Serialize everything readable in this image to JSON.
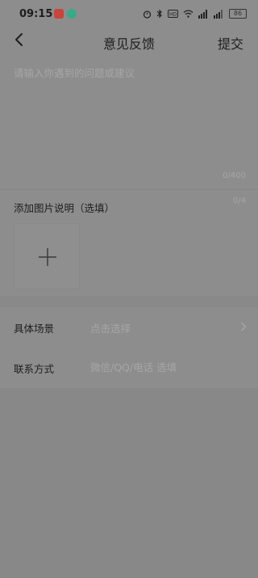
{
  "status_bar": {
    "time": "09:15",
    "battery": "86"
  },
  "header": {
    "title": "意见反馈",
    "submit_label": "提交"
  },
  "feedback": {
    "placeholder": "请输入你遇到的问题或建议",
    "text_counter": "0/400"
  },
  "images": {
    "label": "添加图片说明（选填）",
    "counter": "0/4"
  },
  "scene": {
    "label": "具体场景",
    "value": "点击选择"
  },
  "contact": {
    "label": "联系方式",
    "placeholder": "微信/QQ/电话 选填"
  }
}
